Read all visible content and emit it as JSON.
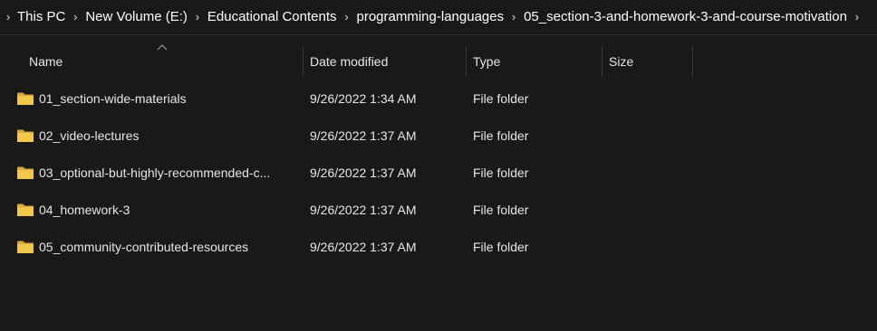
{
  "breadcrumb": {
    "items": [
      "This PC",
      "New Volume (E:)",
      "Educational Contents",
      "programming-languages",
      "05_section-3-and-homework-3-and-course-motivation"
    ]
  },
  "columns": {
    "name": "Name",
    "date_modified": "Date modified",
    "type": "Type",
    "size": "Size"
  },
  "sort": {
    "column": "Name",
    "direction": "ascending"
  },
  "files": [
    {
      "name": "01_section-wide-materials",
      "date": "9/26/2022 1:34 AM",
      "type": "File folder",
      "size": "",
      "icon": "folder-icon"
    },
    {
      "name": "02_video-lectures",
      "date": "9/26/2022 1:37 AM",
      "type": "File folder",
      "size": "",
      "icon": "folder-icon"
    },
    {
      "name": "03_optional-but-highly-recommended-c...",
      "date": "9/26/2022 1:37 AM",
      "type": "File folder",
      "size": "",
      "icon": "folder-icon"
    },
    {
      "name": "04_homework-3",
      "date": "9/26/2022 1:37 AM",
      "type": "File folder",
      "size": "",
      "icon": "folder-icon"
    },
    {
      "name": "05_community-contributed-resources",
      "date": "9/26/2022 1:37 AM",
      "type": "File folder",
      "size": "",
      "icon": "folder-icon"
    }
  ],
  "colors": {
    "background": "#191919",
    "folder": "#f2c84b",
    "text": "#e6e6e6"
  }
}
